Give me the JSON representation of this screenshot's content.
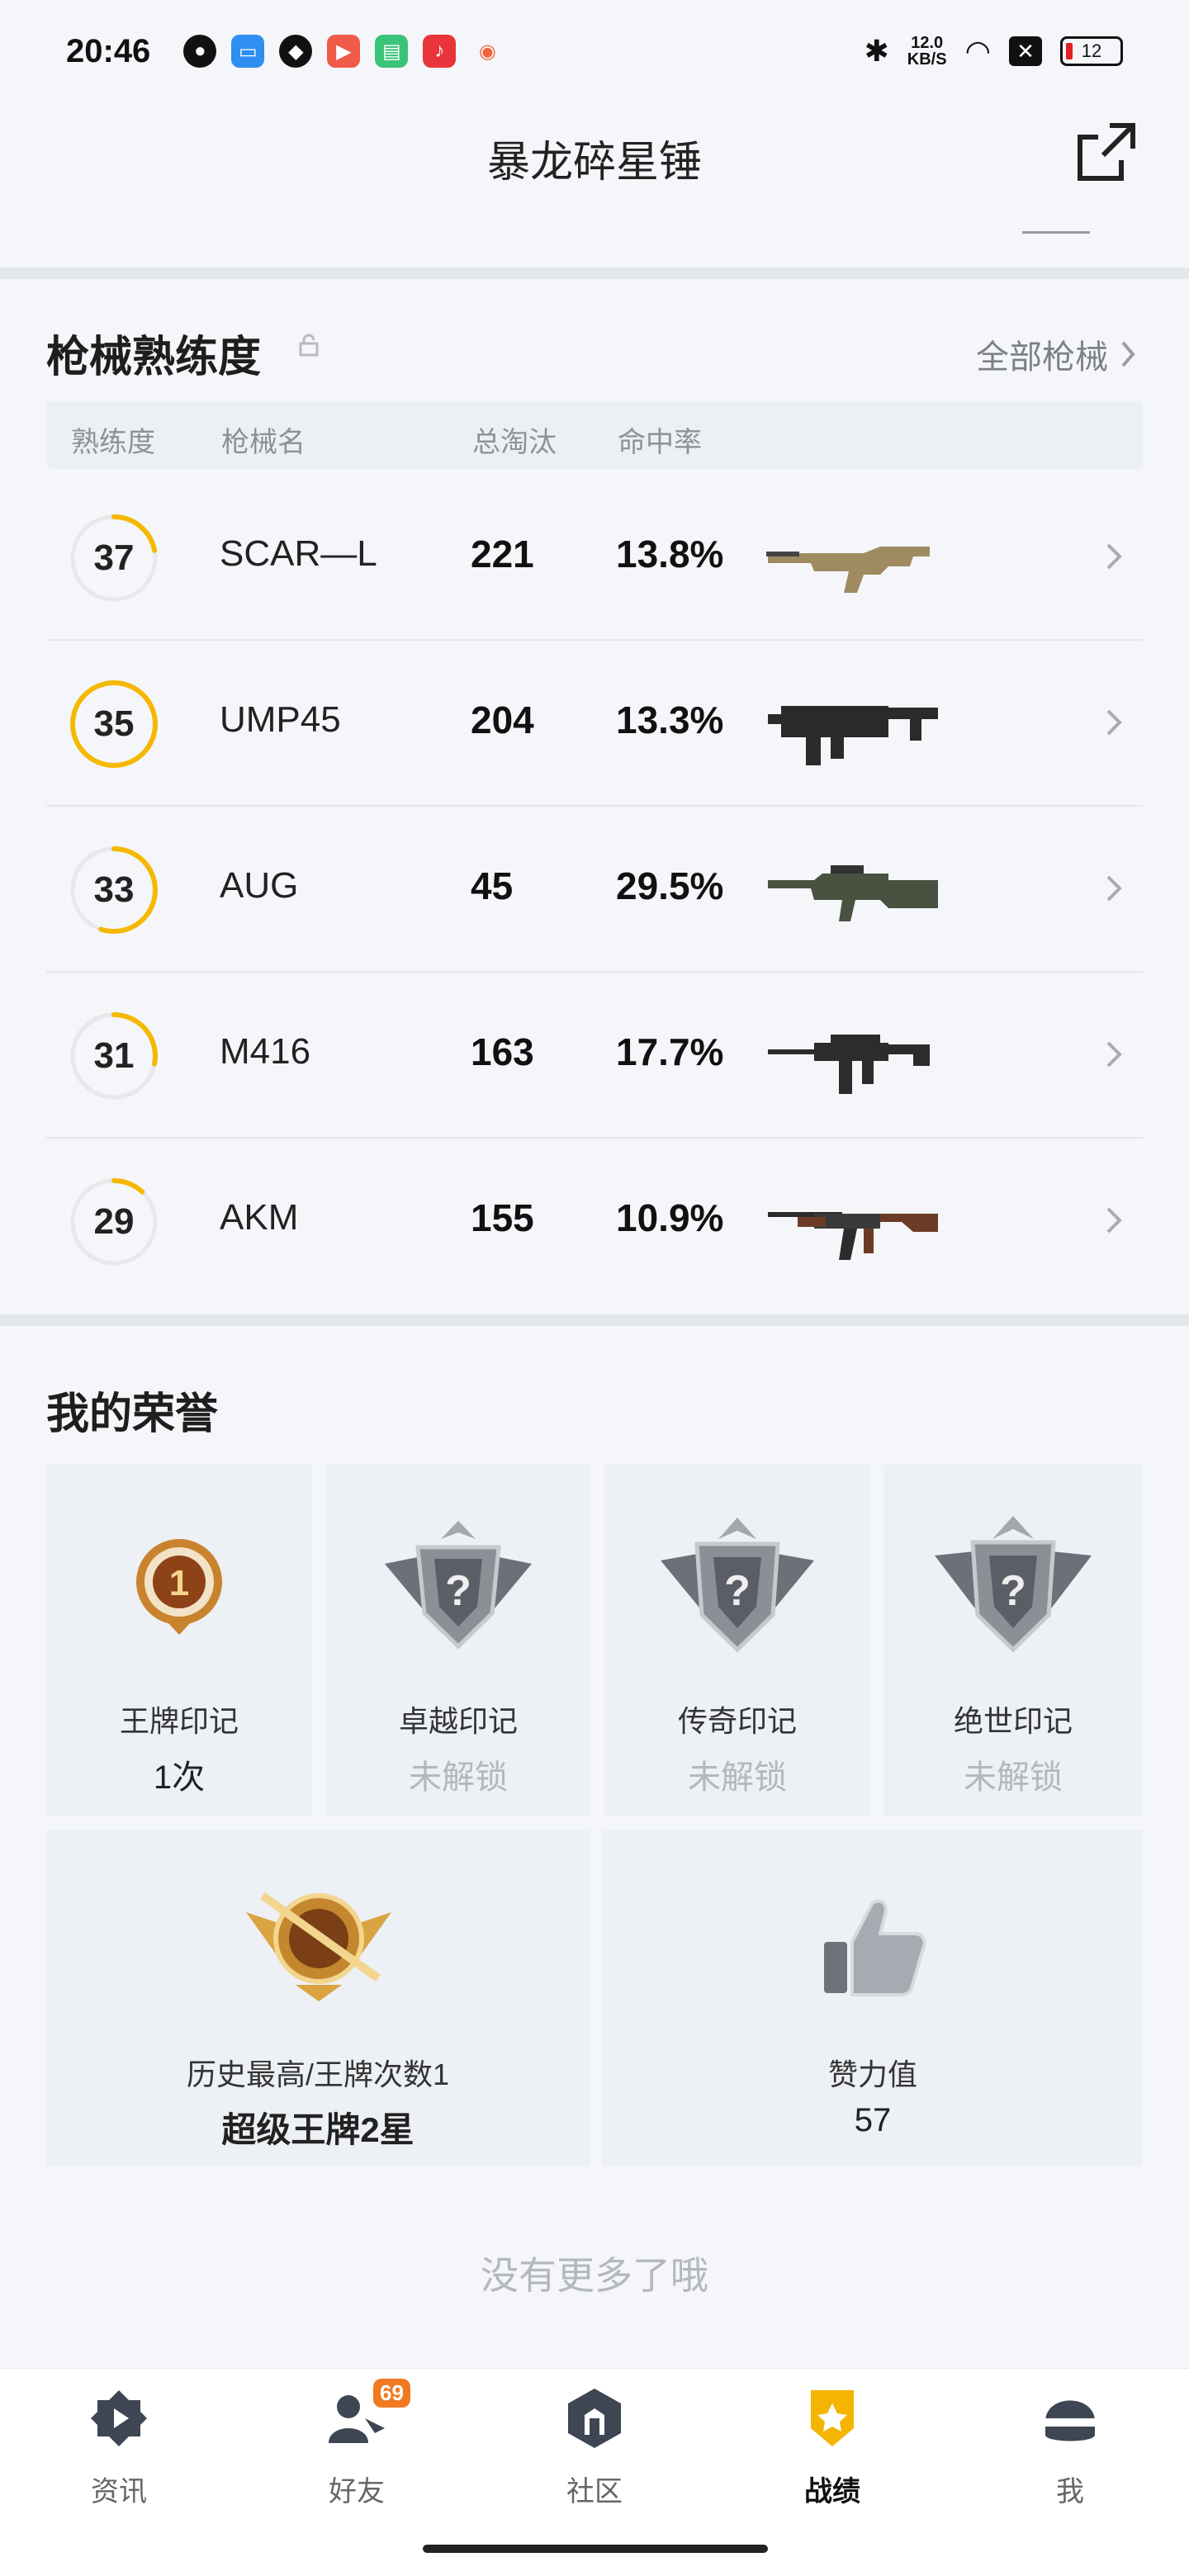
{
  "status_bar": {
    "time": "20:46",
    "net_speed_value": "12.0",
    "net_speed_unit": "KB/S",
    "battery": "12",
    "app_icons": [
      "wechat-icon",
      "files-icon",
      "game-assistant-icon",
      "video-icon",
      "android-icon",
      "music-icon",
      "game-icon"
    ]
  },
  "header": {
    "title": "暴龙碎星锤",
    "share_icon": "share-icon"
  },
  "guns": {
    "title": "枪械熟练度",
    "all_link": "全部枪械",
    "columns": [
      "熟练度",
      "枪械名",
      "总淘汰",
      "命中率"
    ],
    "rows": [
      {
        "level": "37",
        "name": "SCAR—L",
        "eliminations": "221",
        "hit_rate": "13.8%",
        "progress": 0.22,
        "ring_color": "#f5b800"
      },
      {
        "level": "35",
        "name": "UMP45",
        "eliminations": "204",
        "hit_rate": "13.3%",
        "progress": 1.0,
        "ring_color": "#f5b800"
      },
      {
        "level": "33",
        "name": "AUG",
        "eliminations": "45",
        "hit_rate": "29.5%",
        "progress": 0.55,
        "ring_color": "#f5b800"
      },
      {
        "level": "31",
        "name": "M416",
        "eliminations": "163",
        "hit_rate": "17.7%",
        "progress": 0.28,
        "ring_color": "#f5b800"
      },
      {
        "level": "29",
        "name": "AKM",
        "eliminations": "155",
        "hit_rate": "10.9%",
        "progress": 0.12,
        "ring_color": "#f5b800"
      }
    ]
  },
  "honor": {
    "title": "我的荣誉",
    "cards": [
      {
        "label": "王牌印记",
        "value": "1次",
        "locked": false
      },
      {
        "label": "卓越印记",
        "value": "未解锁",
        "locked": true
      },
      {
        "label": "传奇印记",
        "value": "未解锁",
        "locked": true
      },
      {
        "label": "绝世印记",
        "value": "未解锁",
        "locked": true
      }
    ],
    "best": {
      "label": "历史最高/王牌次数1",
      "value": "超级王牌2星"
    },
    "likes": {
      "label": "赞力值",
      "value": "57"
    }
  },
  "footer_note": "没有更多了哦",
  "nav": {
    "items": [
      {
        "label": "资讯",
        "icon": "news-icon",
        "active": false
      },
      {
        "label": "好友",
        "icon": "friends-icon",
        "active": false,
        "badge": "69"
      },
      {
        "label": "社区",
        "icon": "community-icon",
        "active": false
      },
      {
        "label": "战绩",
        "icon": "record-icon",
        "active": true
      },
      {
        "label": "我",
        "icon": "profile-icon",
        "active": false
      }
    ]
  }
}
